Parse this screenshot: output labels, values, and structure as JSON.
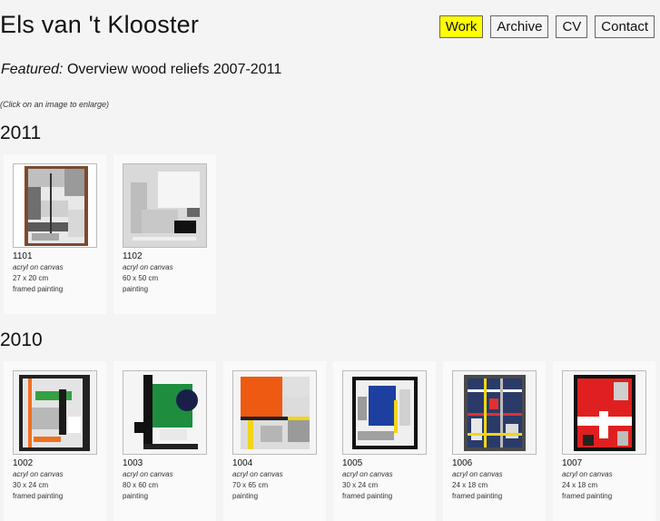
{
  "header": {
    "title": "Els van 't Klooster"
  },
  "nav": {
    "items": [
      "Work",
      "Archive",
      "CV",
      "Contact"
    ],
    "active": "Work"
  },
  "featured": {
    "label": "Featured:",
    "text": "Overview wood reliefs 2007-2011"
  },
  "hint": "(Click on an image to enlarge)",
  "sections": [
    {
      "year": "2011",
      "works": [
        {
          "number": "1101",
          "technique": "acryl on canvas",
          "dimensions": "27 x 20 cm",
          "kind": "framed painting"
        },
        {
          "number": "1102",
          "technique": "acryl on canvas",
          "dimensions": "60 x 50 cm",
          "kind": "painting"
        }
      ]
    },
    {
      "year": "2010",
      "works": [
        {
          "number": "1002",
          "technique": "acryl on canvas",
          "dimensions": "30 x 24 cm",
          "kind": "framed painting"
        },
        {
          "number": "1003",
          "technique": "acryl on canvas",
          "dimensions": "80 x 60 cm",
          "kind": "painting"
        },
        {
          "number": "1004",
          "technique": "acryl on canvas",
          "dimensions": "70 x 65 cm",
          "kind": "painting"
        },
        {
          "number": "1005",
          "technique": "acryl on canvas",
          "dimensions": "30 x 24 cm",
          "kind": "framed painting"
        },
        {
          "number": "1006",
          "technique": "acryl on canvas",
          "dimensions": "24 x 18 cm",
          "kind": "framed painting"
        },
        {
          "number": "1007",
          "technique": "acryl on canvas",
          "dimensions": "24 x 18 cm",
          "kind": "framed painting"
        }
      ]
    }
  ]
}
